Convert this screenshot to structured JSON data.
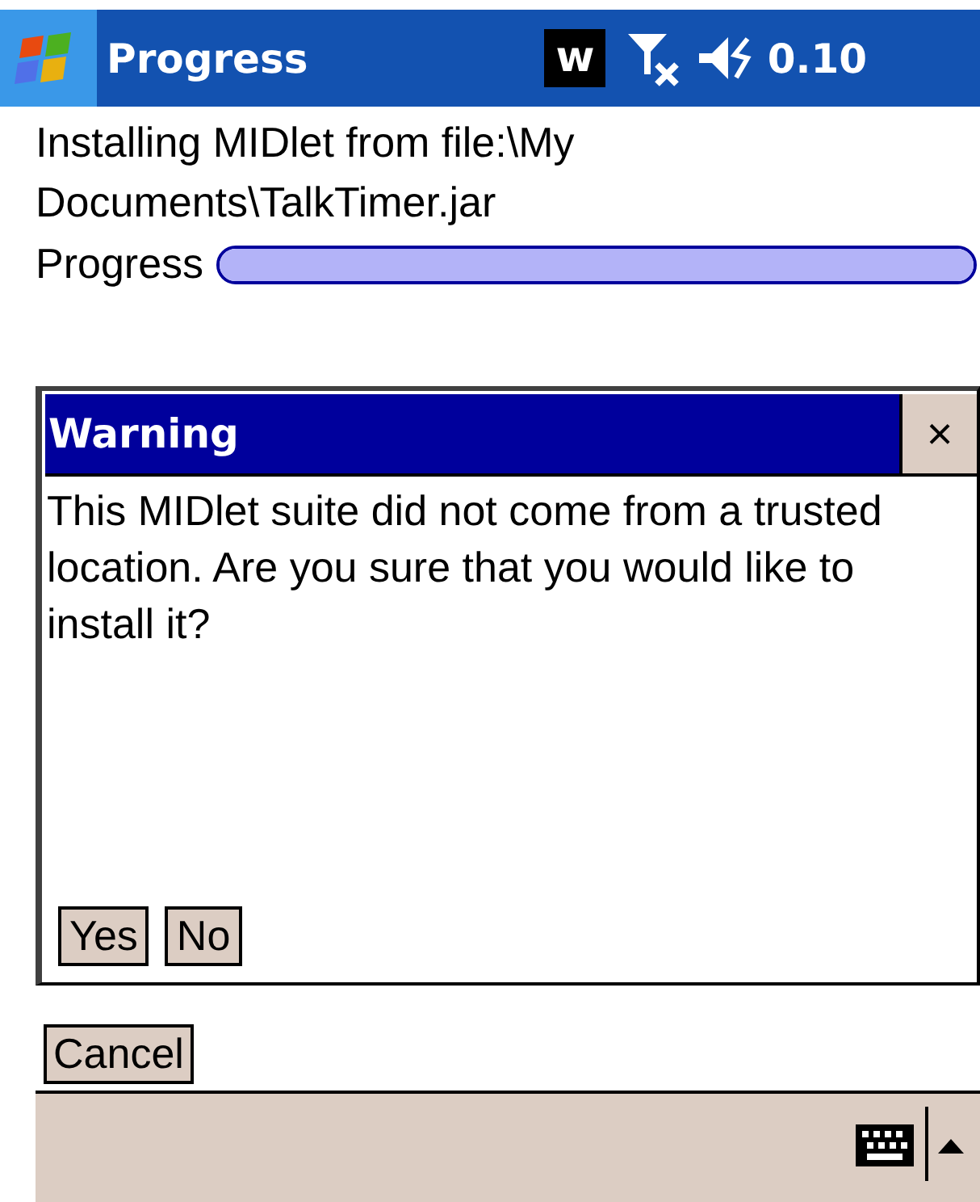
{
  "title_bar": {
    "title": "Progress",
    "badge": "w",
    "clock": "0.10"
  },
  "status": {
    "message": "Installing MIDlet from file:\\My Documents\\TalkTimer.jar",
    "progress_label": "Progress",
    "level": 1
  },
  "dialog": {
    "title": "Warning",
    "close": "×",
    "message": "This MIDlet suite did not come from a trusted location.  Are you sure that you would like to install it?",
    "buttons": [
      "Yes",
      "No"
    ]
  },
  "cancel_button": "Cancel"
}
